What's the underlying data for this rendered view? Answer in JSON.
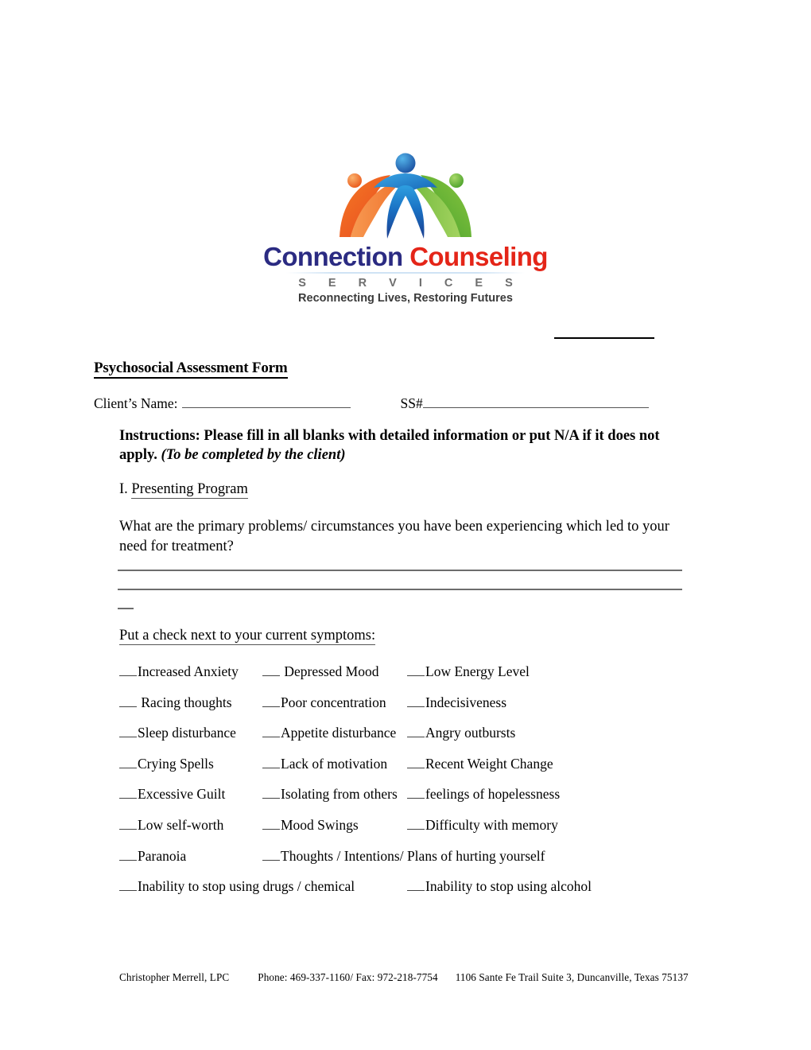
{
  "logo": {
    "icon_name": "three-people-logo",
    "word_1": "Connection",
    "word_2": "Counseling",
    "services": "S E R V I C E S",
    "tagline": "Reconnecting Lives, Restoring Futures",
    "colors": {
      "connection": "#2b2b82",
      "counseling": "#e42518",
      "figure_left": "#ef6024",
      "figure_center": "#1b6fc4",
      "figure_right": "#5fb035",
      "services_gray": "#6e6e6e"
    }
  },
  "document": {
    "title": "Psychosocial Assessment Form ",
    "client_name_label": "Client’s Name:",
    "ss_label": "SS#",
    "instructions_bold": "Instructions:  Please fill in all blanks with detailed information or put N/A if it does not apply. ",
    "instructions_italic": "(To be completed by the client)",
    "section_number": "I. ",
    "section_title": "Presenting Program",
    "question_1": "What are the primary problems/ circumstances you have been experiencing which led to your need for treatment?",
    "check_prompt": "Put a check next to your current symptoms: "
  },
  "symptoms": {
    "rows": [
      {
        "items": [
          {
            "label": "Increased Anxiety",
            "column": 1
          },
          {
            "label": " Depressed Mood",
            "column": 2
          },
          {
            "label": "Low Energy Level",
            "column": 3
          }
        ]
      },
      {
        "items": [
          {
            "label": " Racing thoughts",
            "column": 1
          },
          {
            "label": "Poor concentration",
            "column": 2
          },
          {
            "label": "Indecisiveness",
            "column": 3
          }
        ]
      },
      {
        "items": [
          {
            "label": "Sleep disturbance",
            "column": 1
          },
          {
            "label": "Appetite disturbance",
            "column": 2
          },
          {
            "label": "Angry outbursts",
            "column": 3
          }
        ]
      },
      {
        "items": [
          {
            "label": "Crying Spells",
            "column": 1
          },
          {
            "label": "Lack of motivation",
            "column": 2
          },
          {
            "label": "Recent Weight Change",
            "column": 3
          }
        ]
      },
      {
        "items": [
          {
            "label": "Excessive Guilt",
            "column": 1
          },
          {
            "label": "Isolating from others",
            "column": 2
          },
          {
            "label": "feelings of hopelessness",
            "column": 3
          }
        ]
      },
      {
        "items": [
          {
            "label": "Low self-worth",
            "column": 1
          },
          {
            "label": "Mood Swings",
            "column": 2
          },
          {
            "label": "Difficulty with memory",
            "column": 3
          }
        ]
      },
      {
        "items": [
          {
            "label": "Paranoia",
            "column": 1
          },
          {
            "label": "Thoughts / Intentions/ Plans of hurting yourself",
            "column": 2
          }
        ]
      },
      {
        "items": [
          {
            "label": "Inability to stop using drugs / chemical",
            "column": 1
          },
          {
            "label": "Inability to stop using alcohol",
            "column": 3
          }
        ]
      }
    ]
  },
  "footer": {
    "name": "Christopher Merrell, LPC",
    "contact": "Phone: 469-337-1160/ Fax: 972-218-7754",
    "address": "1106 Sante Fe Trail Suite 3, Duncanville, Texas  75137"
  }
}
